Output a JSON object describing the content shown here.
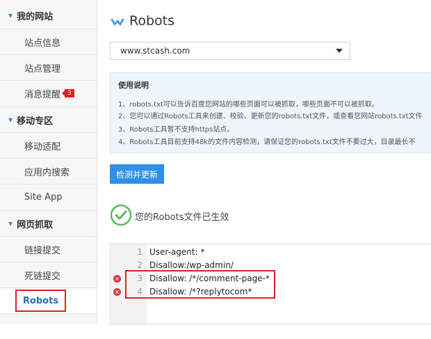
{
  "sidebar": {
    "sections": [
      {
        "title": "我的网站",
        "items": [
          {
            "label": "站点信息"
          },
          {
            "label": "站点管理"
          },
          {
            "label": "消息提醒",
            "badge": "3"
          }
        ]
      },
      {
        "title": "移动专区",
        "items": [
          {
            "label": "移动适配"
          },
          {
            "label": "应用内搜索"
          },
          {
            "label": "Site App"
          }
        ]
      },
      {
        "title": "网页抓取",
        "items": [
          {
            "label": "链接提交"
          },
          {
            "label": "死链提交"
          },
          {
            "label": "Robots"
          }
        ]
      }
    ]
  },
  "header": {
    "title": "Robots"
  },
  "site_select": {
    "value": "www.stcash.com"
  },
  "info": {
    "title": "使用说明",
    "lines": [
      "1、robots.txt可以告诉百度您网站的哪些页面可以被抓取，哪些页面不可以被抓取。",
      "2、您可以通过Robots工具来创建、校验、更新您的robots.txt文件，或查看您网站robots.txt文件",
      "3、Robots工具暂不支持https站点。",
      "4、Robots工具目前支持48k的文件内容检测，请保证您的robots.txt文件不要过大，目录最长不"
    ]
  },
  "check_button": {
    "label": "检测并更新"
  },
  "status": {
    "text": "您的Robots文件已生效"
  },
  "editor": {
    "lines": [
      {
        "num": "1",
        "text": "User-agent: *",
        "error": false
      },
      {
        "num": "2",
        "text": "Disallow:/wp-admin/",
        "error": false
      },
      {
        "num": "3",
        "text": "Disallow:  /*/comment-page-*",
        "error": true
      },
      {
        "num": "4",
        "text": "Disallow:  /*?replytocom*",
        "error": true
      }
    ]
  },
  "colors": {
    "accent": "#2f8fe6",
    "success": "#5cb85c",
    "error": "#d9383e",
    "highlight": "#e02020"
  }
}
